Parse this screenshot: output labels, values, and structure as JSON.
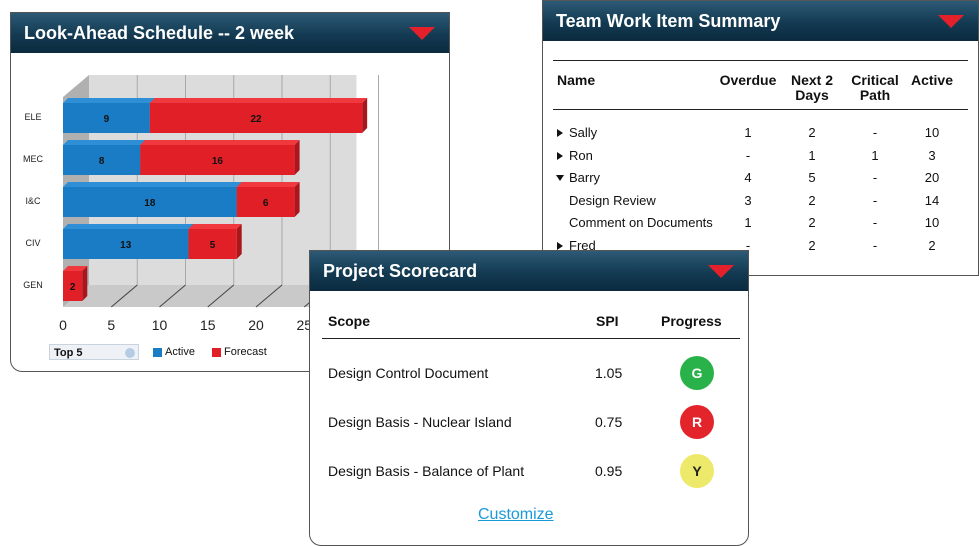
{
  "look_ahead": {
    "title": "Look-Ahead Schedule -- 2 week",
    "select_value": "Top 5",
    "legend": {
      "active": "Active",
      "forecast": "Forecast"
    }
  },
  "chart_data": {
    "type": "bar",
    "orientation": "horizontal",
    "stacked": true,
    "categories": [
      "ELE",
      "MEC",
      "I&C",
      "CIV",
      "GEN"
    ],
    "series": [
      {
        "name": "Active",
        "values": [
          9,
          8,
          18,
          13,
          0
        ],
        "color": "#1a7cc4"
      },
      {
        "name": "Forecast",
        "values": [
          22,
          16,
          6,
          5,
          2
        ],
        "color": "#e01f26"
      }
    ],
    "xticks": [
      "0",
      "5",
      "10",
      "15",
      "20",
      "25"
    ],
    "xlim": [
      0,
      30
    ],
    "grid": true,
    "legend_position": "bottom"
  },
  "team": {
    "title": "Team Work Item Summary",
    "headers": {
      "name": "Name",
      "overdue": "Overdue",
      "next1": "Next 2",
      "next2": "Days",
      "crit1": "Critical",
      "crit2": "Path",
      "active": "Active"
    },
    "rows": [
      {
        "name": "Sally",
        "overdue": "1",
        "next": "2",
        "critical": "-",
        "active": "10",
        "toggle": "collapsed"
      },
      {
        "name": "Ron",
        "overdue": "-",
        "next": "1",
        "critical": "1",
        "active": "3",
        "toggle": "collapsed"
      },
      {
        "name": "Barry",
        "overdue": "4",
        "next": "5",
        "critical": "-",
        "active": "20",
        "toggle": "expanded"
      },
      {
        "name": "Design Review",
        "overdue": "3",
        "next": "2",
        "critical": "-",
        "active": "14",
        "toggle": "none"
      },
      {
        "name": "Comment on Documents",
        "overdue": "1",
        "next": "2",
        "critical": "-",
        "active": "10",
        "toggle": "none"
      },
      {
        "name": "Fred",
        "overdue": "-",
        "next": "2",
        "critical": "-",
        "active": "2",
        "toggle": "collapsed"
      }
    ]
  },
  "scorecard": {
    "title": "Project Scorecard",
    "headers": {
      "scope": "Scope",
      "spi": "SPI",
      "progress": "Progress"
    },
    "rows": [
      {
        "scope": "Design Control Document",
        "spi": "1.05",
        "progress": "G",
        "color": "#2ab24a"
      },
      {
        "scope": "Design Basis - Nuclear Island",
        "spi": "0.75",
        "progress": "R",
        "color": "#e3242b"
      },
      {
        "scope": "Design Basis - Balance of Plant",
        "spi": "0.95",
        "progress": "Y",
        "color": "#ede96a"
      }
    ],
    "customize": "Customize"
  }
}
